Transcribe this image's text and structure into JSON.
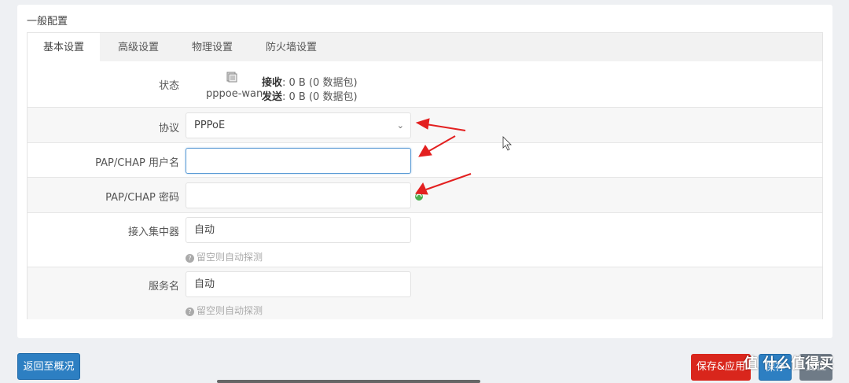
{
  "section_title": "一般配置",
  "tabs": [
    {
      "label": "基本设置",
      "active": true
    },
    {
      "label": "高级设置",
      "active": false
    },
    {
      "label": "物理设置",
      "active": false
    },
    {
      "label": "防火墙设置",
      "active": false
    }
  ],
  "status": {
    "label": "状态",
    "interface": "pppoe-wan",
    "rx_label": "接收",
    "rx_value": ": 0 B (0 数据包)",
    "tx_label": "发送",
    "tx_value": ": 0 B (0 数据包)"
  },
  "protocol": {
    "label": "协议",
    "value": "PPPoE"
  },
  "username": {
    "label": "PAP/CHAP 用户名",
    "value": ""
  },
  "password": {
    "label": "PAP/CHAP 密码",
    "value": ""
  },
  "concentrator": {
    "label": "接入集中器",
    "value": "自动",
    "help": "留空则自动探测"
  },
  "service": {
    "label": "服务名",
    "value": "自动",
    "help": "留空则自动探测"
  },
  "buttons": {
    "back": "返回至概况",
    "save_apply": "保存&应用",
    "save": "保存",
    "reset": "复位"
  },
  "watermark": "值 什么值得买",
  "colors": {
    "primary": "#2d7fc2",
    "danger": "#d9261c",
    "annotation_arrow": "#e32020"
  }
}
